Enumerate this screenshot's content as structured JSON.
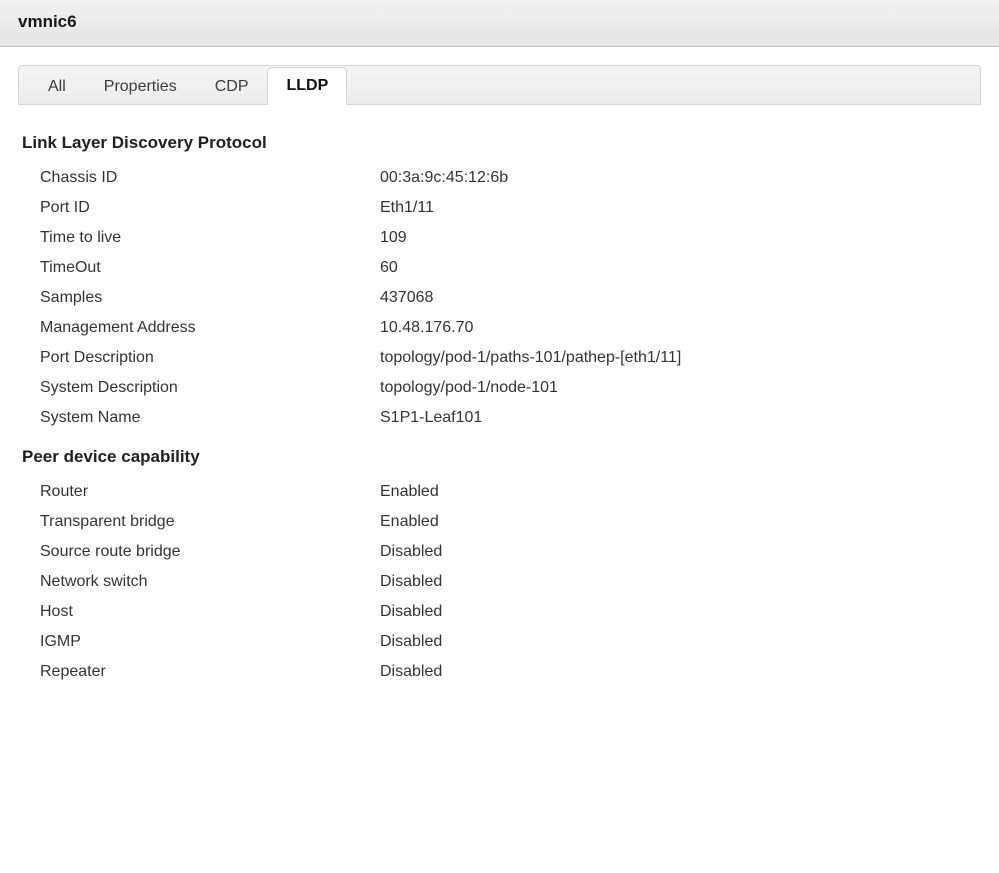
{
  "window": {
    "title": "vmnic6"
  },
  "tabs": {
    "all": "All",
    "properties": "Properties",
    "cdp": "CDP",
    "lldp": "LLDP"
  },
  "sections": {
    "lldp_title": "Link Layer Discovery Protocol",
    "peer_title": "Peer device capability"
  },
  "lldp": {
    "chassis_id": {
      "label": "Chassis ID",
      "value": "00:3a:9c:45:12:6b"
    },
    "port_id": {
      "label": "Port ID",
      "value": "Eth1/11"
    },
    "ttl": {
      "label": "Time to live",
      "value": "109"
    },
    "timeout": {
      "label": "TimeOut",
      "value": "60"
    },
    "samples": {
      "label": "Samples",
      "value": "437068"
    },
    "mgmt_addr": {
      "label": "Management Address",
      "value": "10.48.176.70"
    },
    "port_desc": {
      "label": "Port Description",
      "value": "topology/pod-1/paths-101/pathep-[eth1/11]"
    },
    "sys_desc": {
      "label": "System Description",
      "value": "topology/pod-1/node-101"
    },
    "sys_name": {
      "label": "System Name",
      "value": "S1P1-Leaf101"
    }
  },
  "peer": {
    "router": {
      "label": "Router",
      "value": "Enabled"
    },
    "tbridge": {
      "label": "Transparent bridge",
      "value": "Enabled"
    },
    "srb": {
      "label": "Source route bridge",
      "value": "Disabled"
    },
    "nswitch": {
      "label": "Network switch",
      "value": "Disabled"
    },
    "host": {
      "label": "Host",
      "value": "Disabled"
    },
    "igmp": {
      "label": "IGMP",
      "value": "Disabled"
    },
    "repeater": {
      "label": "Repeater",
      "value": "Disabled"
    }
  }
}
